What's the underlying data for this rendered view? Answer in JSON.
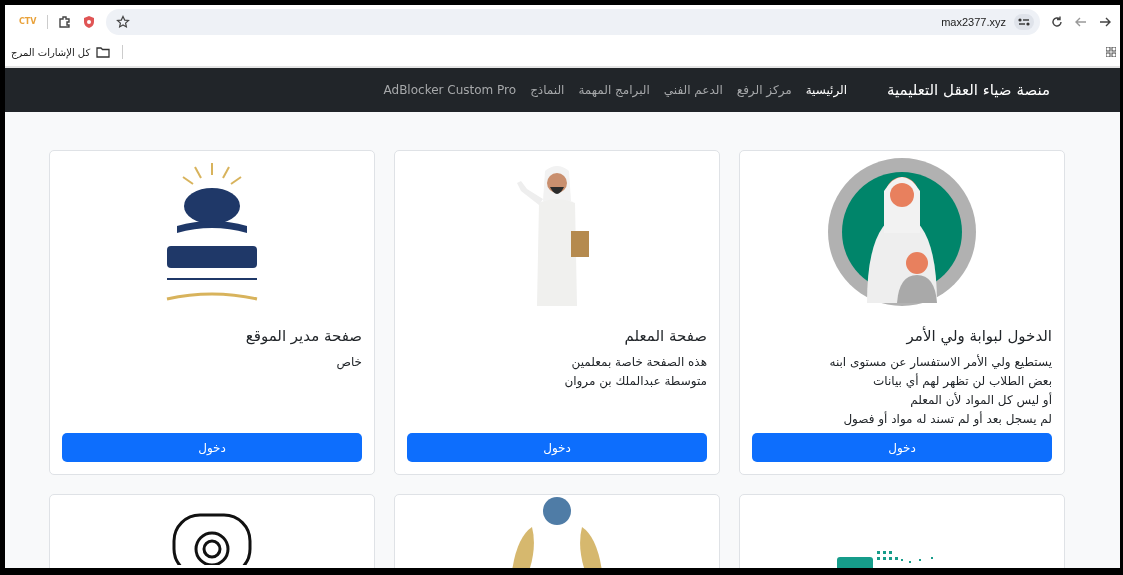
{
  "browser": {
    "extension_label": "CTV",
    "address": "max2377.xyz",
    "bookmark": "كل الإشارات المرج"
  },
  "navbar": {
    "brand": "منصة ضياء العقل التعليمية",
    "links": [
      {
        "label": "الرئيسية",
        "selected": true
      },
      {
        "label": "مركز الرفع",
        "selected": false
      },
      {
        "label": "الدعم الفني",
        "selected": false
      },
      {
        "label": "البرامج المهمة",
        "selected": false
      },
      {
        "label": "النماذج",
        "selected": false
      },
      {
        "label": "AdBlocker Custom Pro",
        "selected": false
      }
    ]
  },
  "cards": [
    {
      "kind": "parent",
      "title": "الدخول لبوابة ولي الأمر",
      "lines": [
        "يستطيع ولي الأمر الاستفسار عن مستوى ابنه",
        "بعض الطلاب لن تظهر لهم أي بيانات",
        "أو ليس كل المواد لأن المعلم",
        "لم يسجل بعد أو لم تسند له مواد أو فصول"
      ],
      "button": "دخول"
    },
    {
      "kind": "teacher",
      "title": "صفحة المعلم",
      "lines": [
        "هذه الصفحة خاصة بمعلمين",
        "متوسطة عبدالملك بن مروان"
      ],
      "button": "دخول"
    },
    {
      "kind": "logo",
      "title": "صفحة مدير الموقع",
      "lines": [
        "خاص"
      ],
      "button": "دخول"
    },
    {
      "kind": "dots"
    },
    {
      "kind": "figures"
    },
    {
      "kind": "gear"
    }
  ]
}
